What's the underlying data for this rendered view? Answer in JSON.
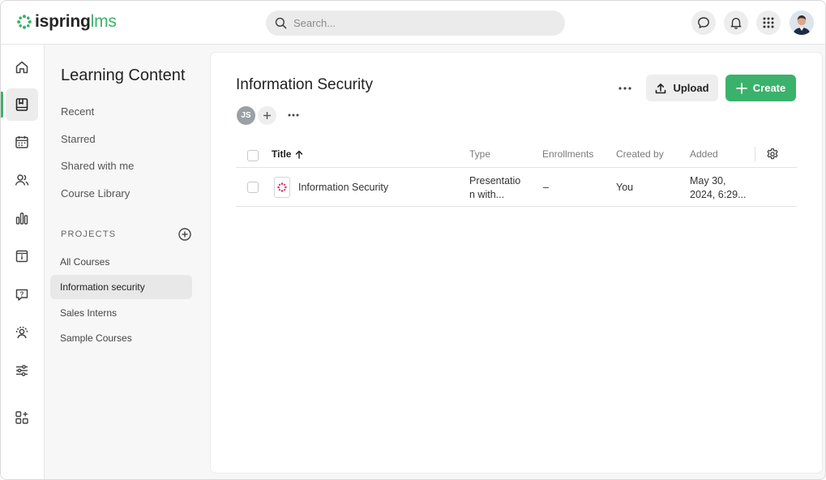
{
  "app": {
    "logo_text": "ispring",
    "logo_suffix": "lms",
    "brand_color": "#3bb26b"
  },
  "search": {
    "placeholder": "Search..."
  },
  "topbar_icons": [
    "chat-icon",
    "bell-icon",
    "apps-grid-icon",
    "user-avatar"
  ],
  "rail": [
    {
      "name": "home-icon",
      "active": false
    },
    {
      "name": "learning-content-icon",
      "active": true
    },
    {
      "name": "calendar-icon",
      "active": false
    },
    {
      "name": "users-icon",
      "active": false
    },
    {
      "name": "reports-icon",
      "active": false
    },
    {
      "name": "info-icon",
      "active": false
    },
    {
      "name": "help-icon",
      "active": false
    },
    {
      "name": "supervisor-icon",
      "active": false
    },
    {
      "name": "settings-sliders-icon",
      "active": false
    },
    {
      "name": "add-apps-icon",
      "active": false
    }
  ],
  "sidebar": {
    "title": "Learning Content",
    "links": [
      "Recent",
      "Starred",
      "Shared with me",
      "Course Library"
    ],
    "projects_header": "PROJECTS",
    "projects": [
      {
        "label": "All Courses",
        "active": false
      },
      {
        "label": "Information security",
        "active": true
      },
      {
        "label": "Sales Interns",
        "active": false
      },
      {
        "label": "Sample Courses",
        "active": false
      }
    ]
  },
  "main": {
    "title": "Information Security",
    "upload_label": "Upload",
    "create_label": "Create",
    "member_initials": "JS",
    "table": {
      "columns": {
        "title": "Title",
        "type": "Type",
        "enrollments": "Enrollments",
        "created_by": "Created by",
        "added": "Added"
      },
      "rows": [
        {
          "title": "Information Security",
          "type_line1": "Presentatio",
          "type_line2": "n with...",
          "enrollments": "–",
          "created_by": "You",
          "added_line1": "May 30,",
          "added_line2": "2024, 6:29..."
        }
      ]
    }
  }
}
